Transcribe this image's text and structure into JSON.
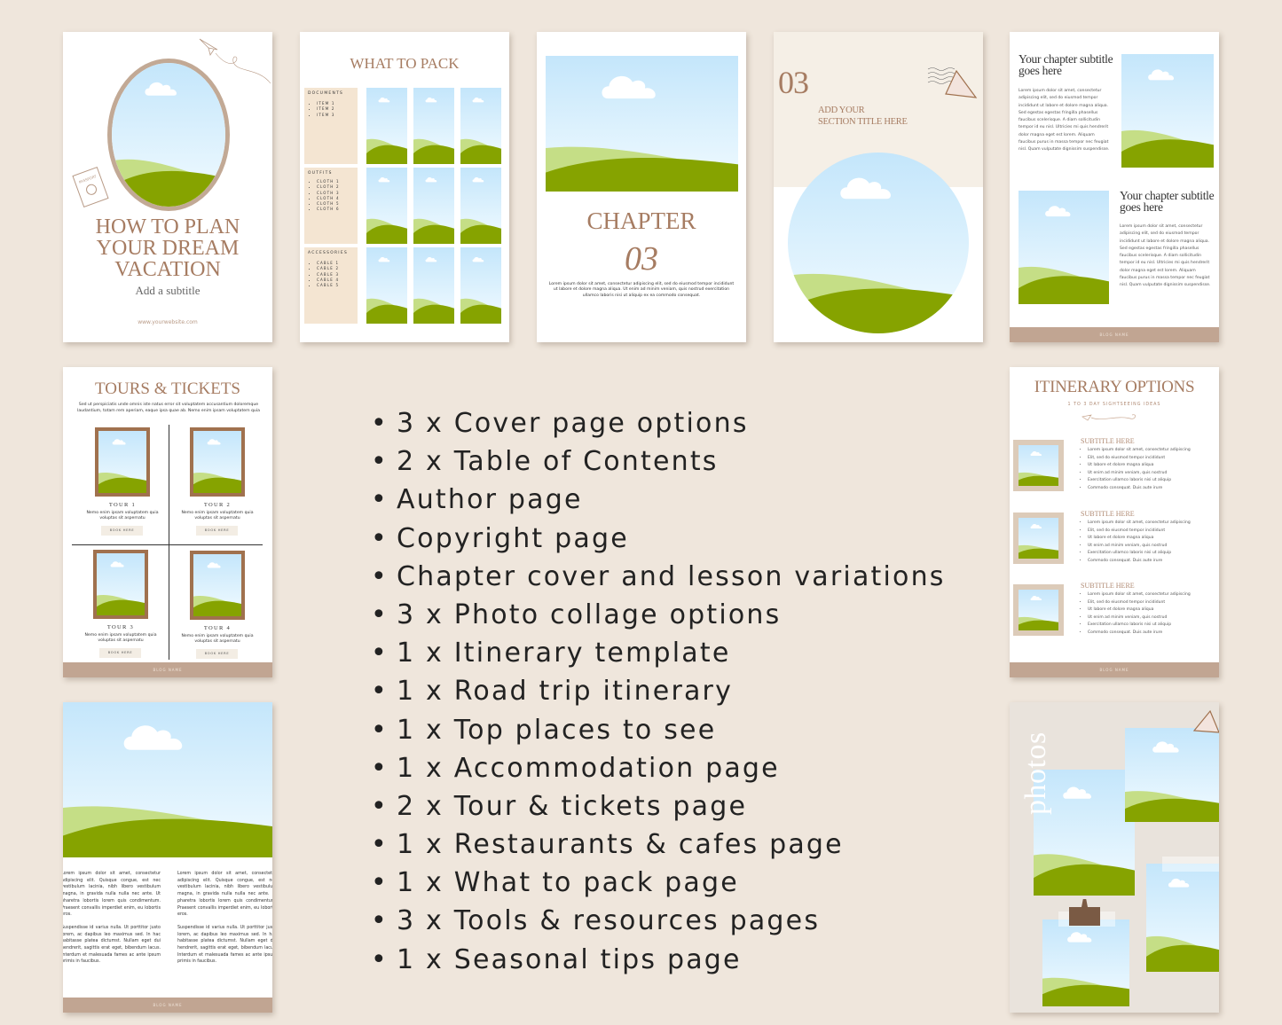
{
  "colors": {
    "background": "#efe6dc",
    "accent": "#a67c62",
    "band": "#c1a592",
    "sky": "#c4e6fb",
    "hill_light": "#c5de86",
    "hill_dark": "#86a300"
  },
  "cover": {
    "title_lines": [
      "HOW TO PLAN",
      "YOUR DREAM",
      "VACATION"
    ],
    "subtitle": "Add a subtitle",
    "website": "www.yourwebsite.com",
    "passport": "PASSPORT"
  },
  "pack": {
    "title": "WHAT TO PACK",
    "sections": [
      {
        "heading": "DOCUMENTS",
        "items": [
          "ITEM 1",
          "ITEM 2",
          "ITEM 3"
        ]
      },
      {
        "heading": "OUTFITS",
        "items": [
          "CLOTH 1",
          "CLOTH 2",
          "CLOTH 3",
          "CLOTH 4",
          "CLOTH 5",
          "CLOTH 6"
        ]
      },
      {
        "heading": "ACCESSORIES",
        "items": [
          "CABLE 1",
          "CABLE 2",
          "CABLE 3",
          "CABLE 4",
          "CABLE 5"
        ]
      }
    ]
  },
  "chapter": {
    "title": "CHAPTER",
    "number": "03",
    "body": "Lorem ipsum dolor sit amet, consectetur adipiscing elit, sed do eiusmod tempor incididunt ut labore et dolore magna aliqua. Ut enim ad minim veniam, quis nostrud exercitation ullamco laboris nisi ut aliquip ex ea commodo consequat."
  },
  "section": {
    "number": "03",
    "title_lines": [
      "ADD YOUR",
      "SECTION TITLE HERE"
    ]
  },
  "subtitle_page": {
    "heading": "Your chapter subtitle goes here",
    "body": "Lorem ipsum dolor sit amet, consectetur adipiscing elit, sed do eiusmod tempor incididunt ut labore et dolore magna aliqua. Sed egestas egestas fringilla phasellus faucibus scelerisque. A diam sollicitudin tempor id eu nisl. Ultricies mi quis hendrerit dolor magna eget est lorem. Aliquam faucibus purus in massa tempor nec feugiat nisl. Quam vulputate dignissim suspendisse.",
    "footer": "BLOG NAME"
  },
  "tours": {
    "title": "TOURS & TICKETS",
    "intro": "Sed ut perspiciatis unde omnis iste natus error sit voluptatem accusantium doloremque laudantium, totam rem aperiam, eaque ipsa quae ab. Nemo enim ipsam voluptatem quia",
    "items": [
      {
        "name": "TOUR 1",
        "desc": "Nemo enim ipsam voluptatem quia voluptas sit aspernatu",
        "button": "BOOK HERE"
      },
      {
        "name": "TOUR 2",
        "desc": "Nemo enim ipsam voluptatem quia voluptas sit aspernatu",
        "button": "BOOK HERE"
      },
      {
        "name": "TOUR 3",
        "desc": "Nemo enim ipsam voluptatem quia voluptas sit aspernatu",
        "button": "BOOK HERE"
      },
      {
        "name": "TOUR 4",
        "desc": "Nemo enim ipsam voluptatem quia voluptas sit aspernatu",
        "button": "BOOK HERE"
      }
    ],
    "footer": "BLOG NAME"
  },
  "features": [
    "3 x Cover page options",
    "2 x Table of Contents",
    "Author page",
    "Copyright page",
    "Chapter cover and lesson variations",
    "3 x Photo collage options",
    "1 x Itinerary template",
    "1 x Road trip itinerary",
    "1 x Top places to see",
    "1 x Accommodation page",
    "2 x Tour & tickets page",
    "1 x Restaurants & cafes page",
    "1 x What to pack page",
    "3 x Tools & resources pages",
    "1 x Seasonal tips page"
  ],
  "itinerary": {
    "title": "ITINERARY OPTIONS",
    "subtitle": "1 TO 3 DAY SIGHTSEEING IDEAS",
    "blocks": [
      {
        "heading": "SUBTITLE HERE",
        "items": [
          "Lorem ipsum dolor sit amet, consectetur adipiscing",
          "Elit, sed do eiusmod tempor incididunt",
          "Ut labore et dolore magna aliqua",
          "Ut enim ad minim veniam, quis nostrud",
          "Exercitation ullamco laboris nisi ut aliquip",
          "Commodo consequat. Duis aute irure"
        ]
      },
      {
        "heading": "SUBTITLE HERE",
        "items": [
          "Lorem ipsum dolor sit amet, consectetur adipiscing",
          "Elit, sed do eiusmod tempor incididunt",
          "Ut labore et dolore magna aliqua",
          "Ut enim ad minim veniam, quis nostrud",
          "Exercitation ullamco laboris nisi ut aliquip",
          "Commodo consequat. Duis aute irure"
        ]
      },
      {
        "heading": "SUBTITLE HERE",
        "items": [
          "Lorem ipsum dolor sit amet, consectetur adipiscing",
          "Elit, sed do eiusmod tempor incididunt",
          "Ut labore et dolore magna aliqua",
          "Ut enim ad minim veniam, quis nostrud",
          "Exercitation ullamco laboris nisi ut aliquip",
          "Commodo consequat. Duis aute irure"
        ]
      }
    ],
    "footer": "BLOG NAME"
  },
  "text_page": {
    "para1": "Lorem ipsum dolor sit amet, consectetur adipiscing elit. Quisque congue, est nec vestibulum lacinia, nibh libero vestibulum magna, in gravida nulla nulla nec ante. Ut pharetra lobortis lorem quis condimentum. Praesent convallis imperdiet enim, eu lobortis eros.",
    "para2": "Suspendisse id varius nulla. Ut porttitor justo lorem, ac dapibus leo maximus sed. In hac habitasse platea dictumst. Nullam eget dui hendrerit, sagittis erat eget, bibendum lacus. Interdum et malesuada fames ac ante ipsum primis in faucibus.",
    "footer": "BLOG NAME"
  },
  "photos": {
    "label": "photos"
  }
}
